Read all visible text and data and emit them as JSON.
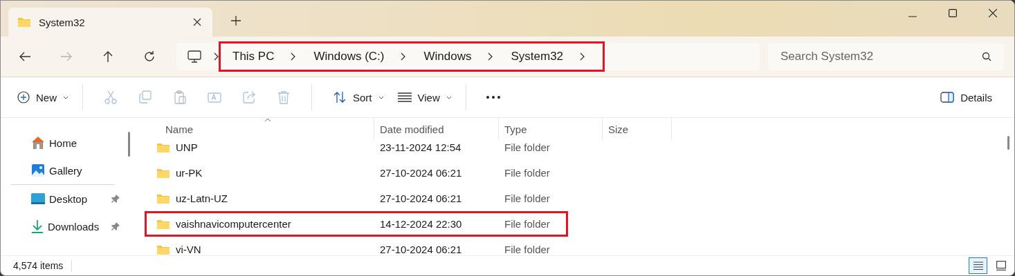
{
  "tabs": [
    {
      "title": "System32",
      "selected": true
    }
  ],
  "nav_buttons": [
    {
      "kind": "back",
      "disabled": false
    },
    {
      "kind": "forward",
      "disabled": true
    },
    {
      "kind": "up",
      "disabled": false
    },
    {
      "kind": "refresh",
      "disabled": false
    }
  ],
  "address": {
    "highlighted": true,
    "crumbs": [
      "This PC",
      "Windows (C:)",
      "Windows",
      "System32"
    ]
  },
  "search": {
    "placeholder": "Search System32"
  },
  "toolbar": [
    {
      "kind": "new",
      "label": "New",
      "disabled": false
    },
    {
      "kind": "cut",
      "disabled": true
    },
    {
      "kind": "copy",
      "disabled": true
    },
    {
      "kind": "paste",
      "disabled": true
    },
    {
      "kind": "rename",
      "disabled": true
    },
    {
      "kind": "share",
      "disabled": true
    },
    {
      "kind": "delete",
      "disabled": true
    },
    {
      "kind": "sort",
      "label": "Sort",
      "disabled": false
    },
    {
      "kind": "view",
      "label": "View",
      "disabled": false
    },
    {
      "kind": "more",
      "disabled": false
    }
  ],
  "details_button": {
    "label": "Details"
  },
  "sidebar": {
    "items": [
      {
        "kind": "home",
        "label": "Home",
        "pinned": false
      },
      {
        "kind": "gallery",
        "label": "Gallery",
        "pinned": false
      },
      {
        "kind": "desktop",
        "label": "Desktop",
        "pinned": true
      },
      {
        "kind": "downloads",
        "label": "Downloads",
        "pinned": true
      }
    ]
  },
  "table": {
    "columns": [
      "Name",
      "Date modified",
      "Type",
      "Size"
    ],
    "rows": [
      {
        "name": "UNP",
        "date": "23-11-2024 12:54",
        "type": "File folder",
        "highlighted": false
      },
      {
        "name": "ur-PK",
        "date": "27-10-2024 06:21",
        "type": "File folder",
        "highlighted": false
      },
      {
        "name": "uz-Latn-UZ",
        "date": "27-10-2024 06:21",
        "type": "File folder",
        "highlighted": false
      },
      {
        "name": "vaishnavicomputercenter",
        "date": "14-12-2024 22:30",
        "type": "File folder",
        "highlighted": true
      },
      {
        "name": "vi-VN",
        "date": "27-10-2024 06:21",
        "type": "File folder",
        "highlighted": false
      }
    ]
  },
  "status_bar": {
    "count": "4,574 items",
    "views": [
      {
        "kind": "details",
        "selected": true
      },
      {
        "kind": "tiles",
        "selected": false
      }
    ]
  }
}
